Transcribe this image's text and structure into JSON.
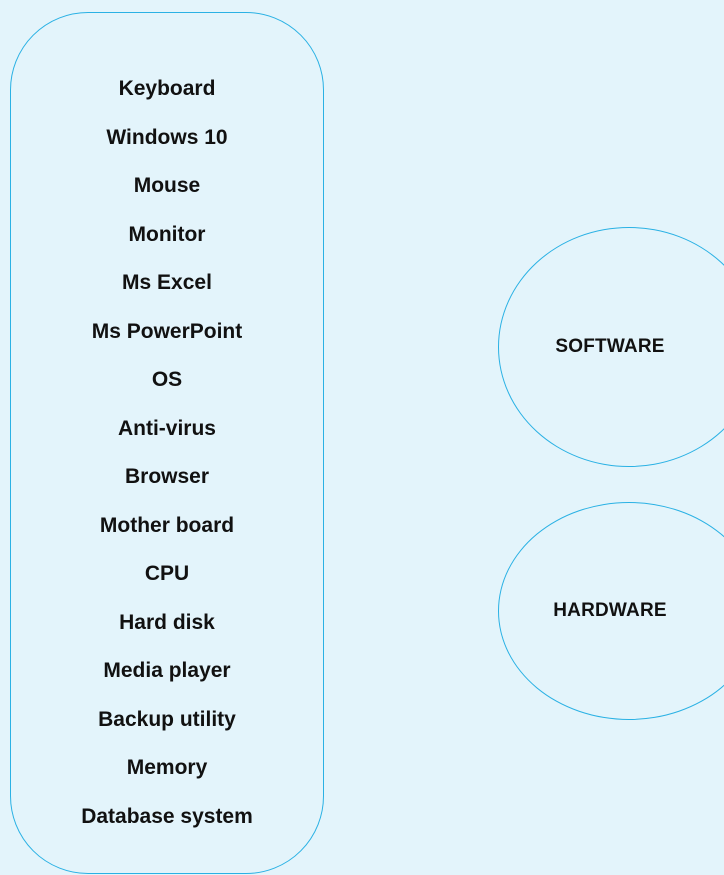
{
  "items_panel": {
    "items": [
      "Keyboard",
      "Windows 10",
      "Mouse",
      "Monitor",
      "Ms Excel",
      "Ms PowerPoint",
      "OS",
      "Anti-virus",
      "Browser",
      "Mother board",
      "CPU",
      "Hard disk",
      "Media player",
      "Backup utility",
      "Memory",
      "Database system"
    ]
  },
  "categories": {
    "software": "SOFTWARE",
    "hardware": "HARDWARE"
  },
  "colors": {
    "background": "#e3f4fb",
    "outline": "#2ab1e4",
    "text": "#111111"
  }
}
